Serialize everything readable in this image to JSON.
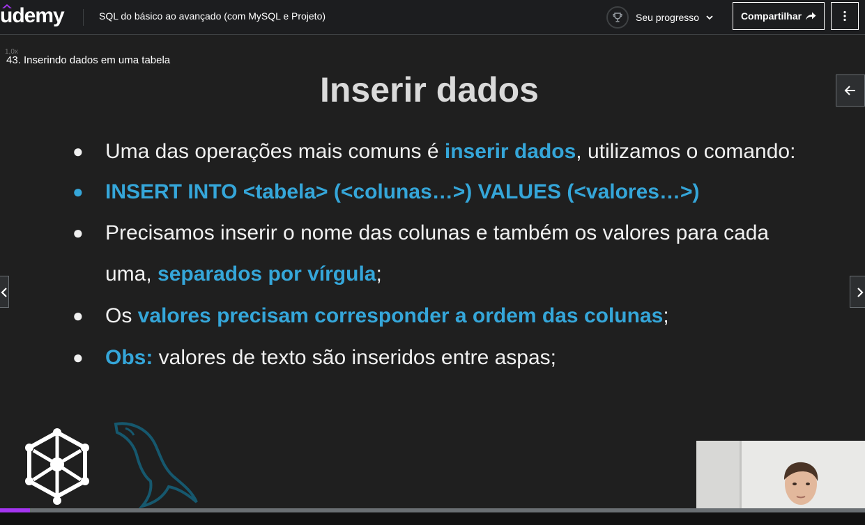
{
  "header": {
    "logo": "udemy",
    "course_title": "SQL do básico ao avançado (com MySQL e Projeto)",
    "progress_label": "Seu progresso",
    "share_label": "Compartilhar"
  },
  "player": {
    "speed_label": "1,0x",
    "lecture_title": "43. Inserindo dados em uma tabela",
    "progress_fraction": 0.035,
    "accent_color": "#a435f0"
  },
  "slide": {
    "title": "Inserir dados",
    "highlight_color": "#35a6d9",
    "bullet_glyph": "●",
    "bullets": [
      {
        "pre": "Uma das operações mais comuns é ",
        "hl": "inserir dados",
        "post": ", utilizamos o comando:"
      },
      {
        "hl": "INSERT INTO <tabela> (<colunas…>) VALUES (<valores…>)"
      },
      {
        "line1": "Precisamos inserir o nome das colunas e também os valores para cada",
        "pre2": "uma, ",
        "hl": "separados por vírgula",
        "post": ";"
      },
      {
        "pre": "Os ",
        "hl": "valores precisam corresponder a ordem das colunas",
        "post": ";"
      },
      {
        "hl": "Obs:",
        "post": " valores de texto são inseridos entre aspas;"
      }
    ]
  },
  "icons": {
    "trophy": "trophy-icon",
    "chevron": "chevron-down-icon",
    "share": "share-arrow-icon",
    "more": "more-vertical-icon",
    "back": "arrow-left-icon",
    "prev": "chevron-left-icon",
    "next": "chevron-right-icon"
  }
}
